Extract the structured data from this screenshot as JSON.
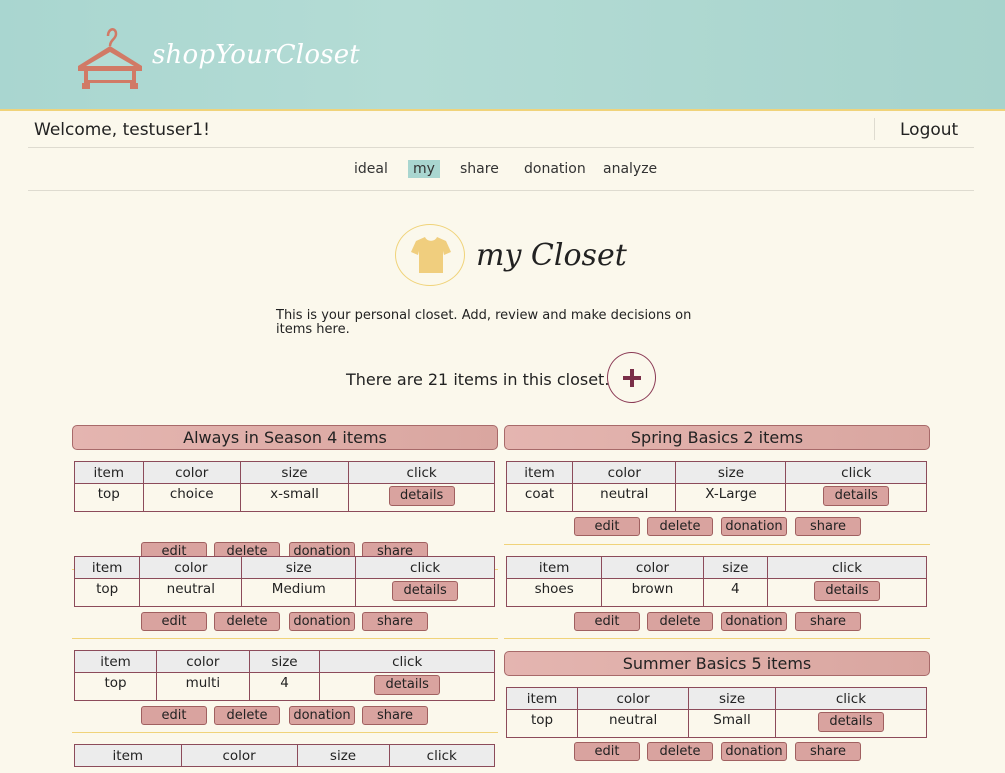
{
  "brand": {
    "name": "shopYourCloset"
  },
  "header": {
    "welcome": "Welcome, testuser1!",
    "logout_label": "Logout"
  },
  "nav": {
    "items": [
      "ideal",
      "my",
      "share",
      "donation",
      "analyze"
    ],
    "active": "my"
  },
  "page": {
    "title": "my Closet",
    "intro": "This is your personal closet. Add, review and make decisions on items here.",
    "count_text": "There are 21 items in this closet."
  },
  "table_headers": {
    "item": "item",
    "color": "color",
    "size": "size",
    "click": "click"
  },
  "labels": {
    "details": "details",
    "edit": "edit",
    "delete": "delete",
    "donation": "donation",
    "share": "share"
  },
  "categories": {
    "always": {
      "title": "Always in Season 4 items",
      "items": [
        {
          "item": "top",
          "color": "choice",
          "size": "x-small"
        },
        {
          "item": "top",
          "color": "neutral",
          "size": "Medium"
        },
        {
          "item": "top",
          "color": "multi",
          "size": "4"
        }
      ]
    },
    "spring": {
      "title": "Spring Basics 2 items",
      "items": [
        {
          "item": "coat",
          "color": "neutral",
          "size": "X-Large"
        },
        {
          "item": "shoes",
          "color": "brown",
          "size": "4"
        }
      ]
    },
    "summer": {
      "title": "Summer Basics 5 items",
      "items": [
        {
          "item": "top",
          "color": "neutral",
          "size": "Small"
        }
      ]
    }
  },
  "colors": {
    "header_bg": "#a9d6d0",
    "page_bg": "#fbf8ec",
    "accent_pink": "#d9a39f",
    "accent_gold": "#f0d37a",
    "brand_icon": "#d17a66"
  },
  "icons": {
    "logo": "hanger-icon",
    "closet": "tshirt-icon",
    "add": "plus-icon"
  }
}
